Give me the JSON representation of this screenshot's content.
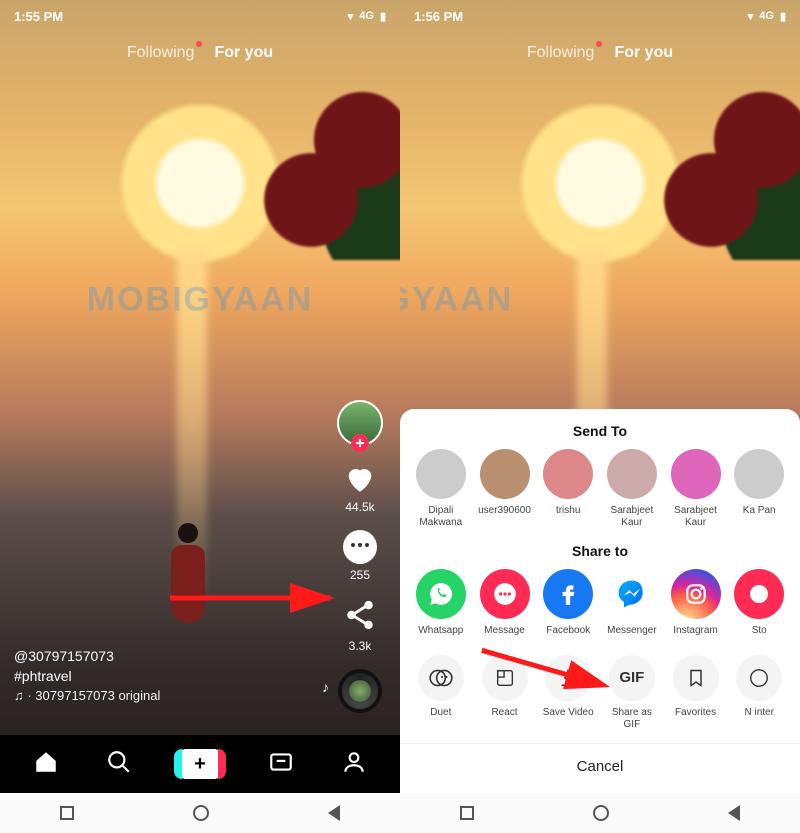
{
  "left": {
    "status": {
      "time": "1:55 PM",
      "net": "4G"
    },
    "nav": {
      "following": "Following",
      "foryou": "For you"
    },
    "sidebar": {
      "likes": "44.5k",
      "comments": "255",
      "shares": "3.3k"
    },
    "meta": {
      "user": "@30797157073",
      "hashtag": "#phtravel",
      "sound": "♫  · 30797157073   original"
    }
  },
  "right": {
    "status": {
      "time": "1:56 PM",
      "net": "4G"
    },
    "nav": {
      "following": "Following",
      "foryou": "For you"
    },
    "sheet": {
      "sendto_title": "Send To",
      "contacts": [
        {
          "name": "Dipali Makwana"
        },
        {
          "name": "user390600"
        },
        {
          "name": "trishu"
        },
        {
          "name": "Sarabjeet Kaur"
        },
        {
          "name": "Sarabjeet Kaur"
        },
        {
          "name": "Ka Pan"
        }
      ],
      "shareto_title": "Share to",
      "share_options": [
        {
          "label": "Whatsapp",
          "color": "#25D366",
          "icon": "whatsapp"
        },
        {
          "label": "Message",
          "color": "#FE2C55",
          "icon": "message"
        },
        {
          "label": "Facebook",
          "color": "#1877F2",
          "icon": "facebook"
        },
        {
          "label": "Messenger",
          "color": "#ffffff",
          "icon": "messenger"
        },
        {
          "label": "Instagram",
          "color": "gradient",
          "icon": "instagram"
        },
        {
          "label": "Sto",
          "color": "#FE2C55",
          "icon": "story"
        }
      ],
      "actions": [
        {
          "label": "Duet",
          "icon": "duet"
        },
        {
          "label": "React",
          "icon": "react"
        },
        {
          "label": "Save Video",
          "icon": "download"
        },
        {
          "label": "Share as GIF",
          "icon": "gif"
        },
        {
          "label": "Favorites",
          "icon": "bookmark"
        },
        {
          "label": "N inter",
          "icon": "block"
        }
      ],
      "cancel": "Cancel"
    }
  },
  "watermark": "MOBIGYAAN"
}
